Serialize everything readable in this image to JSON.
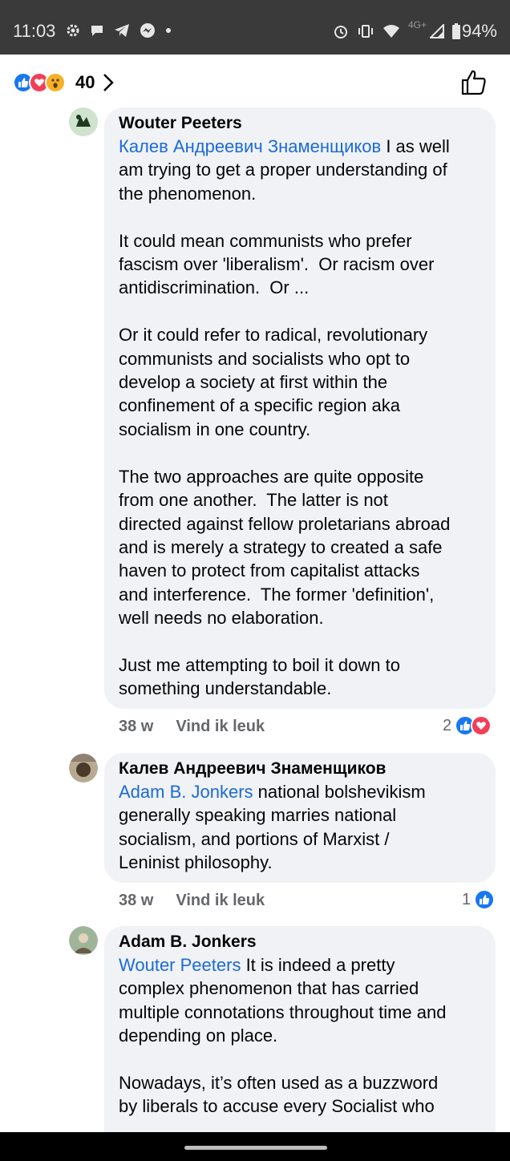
{
  "status_bar": {
    "time": "11:03",
    "network_label": "4G+",
    "battery": "94%",
    "left_icons": [
      "settings-icon",
      "chat-icon",
      "telegram-icon",
      "messenger-icon",
      "dot-icon"
    ],
    "right_icons": [
      "alarm-icon",
      "vibrate-icon",
      "wifi-icon",
      "signal-icon",
      "battery-icon"
    ]
  },
  "reactions_header": {
    "types": [
      "like",
      "love",
      "wow"
    ],
    "count": "40",
    "colors": {
      "like": "#1877f2",
      "love": "#f33e58",
      "wow": "#f7b125"
    }
  },
  "comments": [
    {
      "author": "Wouter Peeters",
      "mention": "Калев Андреевич Знаменщиков",
      "text_after_mention": " I as well\nam trying to get a proper understanding of\nthe phenomenon.\n\nIt could mean communists who prefer\nfascism over 'liberalism'.  Or racism over\nantidiscrimination.  Or ...\n\nOr it could refer to radical, revolutionary\ncommunists and socialists who opt to\ndevelop a society at first within the\nconfinement of a specific region aka\nsocialism in one country.\n\nThe two approaches are quite opposite\nfrom one another.  The latter is not\ndirected against fellow proletarians abroad\nand is merely a strategy to created a safe\nhaven to protect from capitalist attacks\nand interference.  The former 'definition',\nwell needs no elaboration.\n\nJust me attempting to boil it down to\nsomething understandable.",
      "time": "38 w",
      "like_label": "Vind ik leuk",
      "reaction_count": "2",
      "reaction_types": [
        "like",
        "love"
      ]
    },
    {
      "author": "Калев Андреевич Знаменщиков",
      "mention": "Adam B. Jonkers",
      "text_after_mention": " national bolshevikism\ngenerally speaking marries national\nsocialism, and portions of Marxist /\nLeninist philosophy.",
      "time": "38 w",
      "like_label": "Vind ik leuk",
      "reaction_count": "1",
      "reaction_types": [
        "like"
      ]
    },
    {
      "author": "Adam B. Jonkers",
      "mention": "Wouter Peeters",
      "text_after_mention": " It is indeed a pretty\ncomplex phenomenon that has carried\nmultiple connotations throughout time and\ndepending on place.\n\nNowadays, it’s often used as a buzzword\nby liberals to accuse every Socialist who"
    }
  ]
}
